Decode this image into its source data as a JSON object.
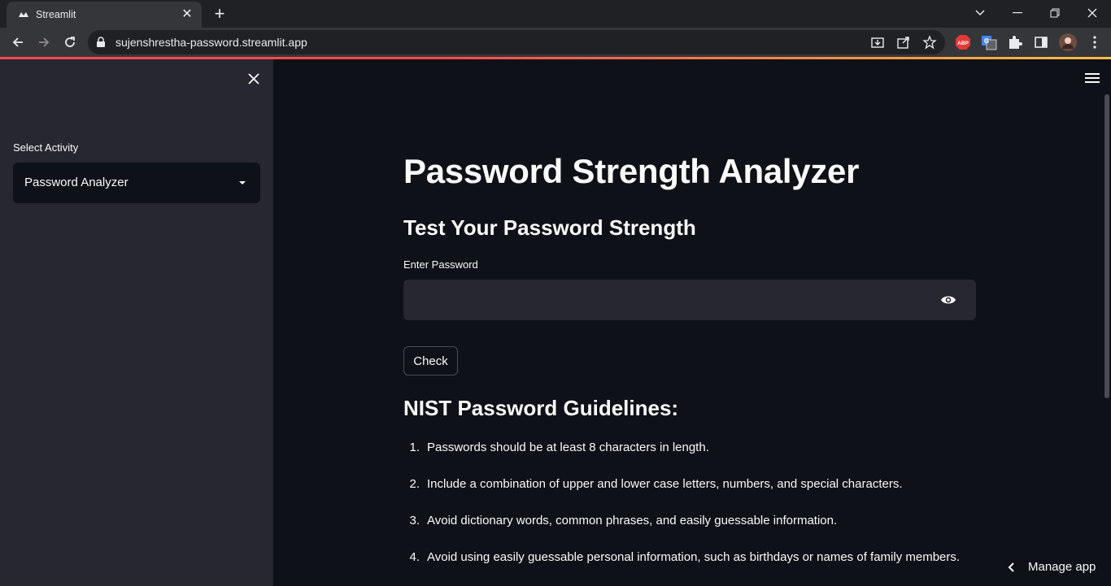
{
  "browser": {
    "tab_title": "Streamlit",
    "url": "sujenshrestha-password.streamlit.app",
    "extensions": [
      "abp-icon",
      "translate-icon",
      "puzzle-icon",
      "sidepanel-icon",
      "profile-avatar"
    ]
  },
  "sidebar": {
    "select_label": "Select Activity",
    "select_value": "Password Analyzer"
  },
  "main": {
    "title": "Password Strength Analyzer",
    "subtitle": "Test Your Password Strength",
    "password_label": "Enter Password",
    "password_value": "",
    "check_button": "Check",
    "guidelines_heading": "NIST Password Guidelines:",
    "guidelines": [
      {
        "num": "1.",
        "text": "Passwords should be at least 8 characters in length."
      },
      {
        "num": "2.",
        "text": "Include a combination of upper and lower case letters, numbers, and special characters."
      },
      {
        "num": "3.",
        "text": "Avoid dictionary words, common phrases, and easily guessable information."
      },
      {
        "num": "4.",
        "text": "Avoid using easily guessable personal information, such as birthdays or names of family members."
      }
    ]
  },
  "footer": {
    "manage_app": "Manage app"
  },
  "colors": {
    "background": "#0e1117",
    "sidebar": "#262730",
    "text": "#fafafa",
    "accent": "#ff4b4b"
  }
}
